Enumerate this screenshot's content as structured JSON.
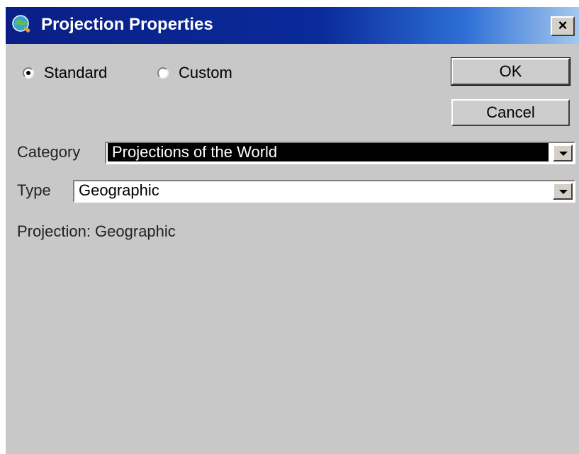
{
  "window": {
    "title": "Projection Properties",
    "close_glyph": "×",
    "app_icon": "globe-icon",
    "close_icon": "close-icon"
  },
  "mode": {
    "options": [
      {
        "label": "Standard",
        "selected": true
      },
      {
        "label": "Custom",
        "selected": false
      }
    ]
  },
  "buttons": {
    "ok": "OK",
    "cancel": "Cancel"
  },
  "category": {
    "label": "Category",
    "value": "Projections of the World"
  },
  "type": {
    "label": "Type",
    "value": "Geographic"
  },
  "projection": {
    "text": "Projection: Geographic"
  },
  "colors": {
    "title_bar": "#0a1f86",
    "selection_bg": "#000000",
    "dialog_bg": "#c8c8c8"
  }
}
